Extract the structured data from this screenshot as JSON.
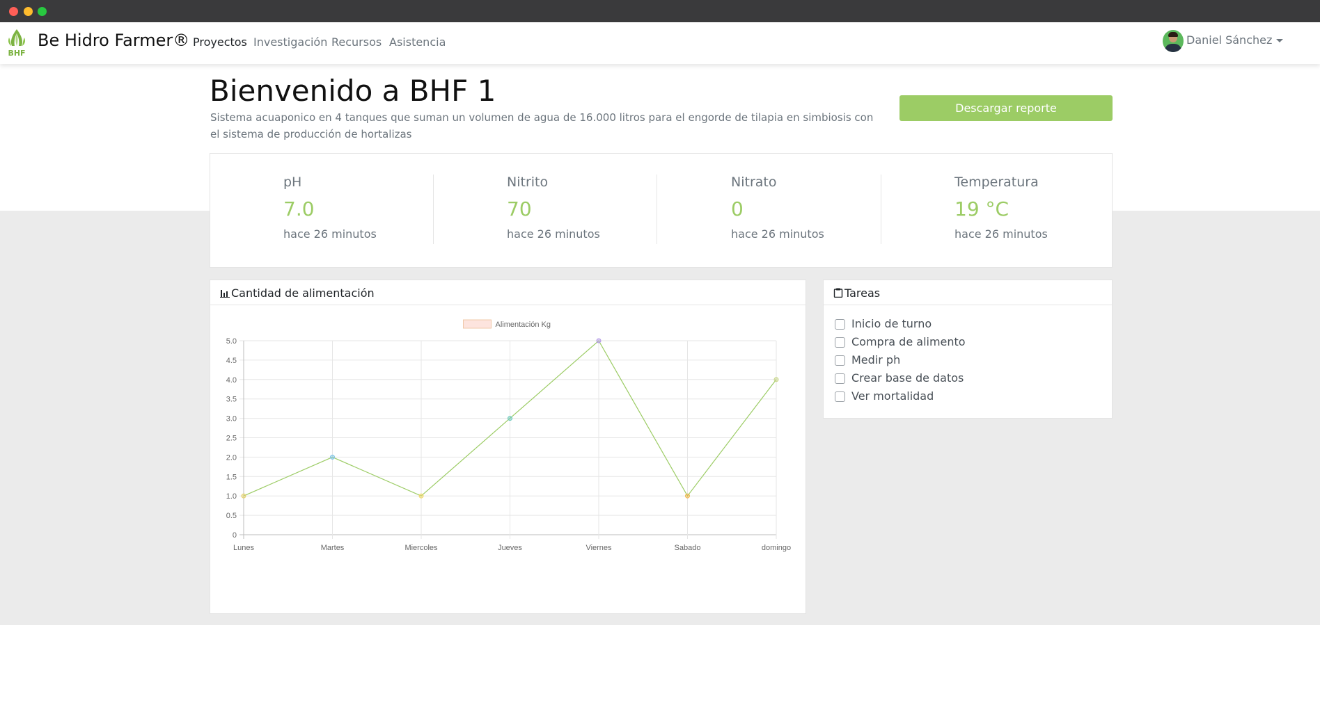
{
  "brand": {
    "logo_text": "BHF",
    "name": "Be Hidro Farmer®",
    "accent": "#9ccc65"
  },
  "nav": {
    "items": [
      {
        "label": "Proyectos",
        "active": true
      },
      {
        "label": "Investigación",
        "active": false
      },
      {
        "label": "Recursos",
        "active": false
      },
      {
        "label": "Asistencia",
        "active": false
      }
    ]
  },
  "user": {
    "name": "Daniel Sánchez"
  },
  "header": {
    "title": "Bienvenido a BHF 1",
    "description": "Sistema acuaponico en 4 tanques que suman un volumen de agua de 16.000 litros para el engorde de tilapia en simbiosis con el sistema de producción de hortalizas",
    "download_label": "Descargar reporte"
  },
  "stats": [
    {
      "label": "pH",
      "value": "7.0",
      "time": "hace 26 minutos"
    },
    {
      "label": "Nitrito",
      "value": "70",
      "time": "hace 26 minutos"
    },
    {
      "label": "Nitrato",
      "value": "0",
      "time": "hace 26 minutos"
    },
    {
      "label": "Temperatura",
      "value": "19 °C",
      "time": "hace 26 minutos"
    }
  ],
  "chart_card": {
    "title": "Cantidad de alimentación",
    "icon": "bar-chart-icon"
  },
  "chart_data": {
    "type": "line",
    "categories": [
      "Lunes",
      "Martes",
      "Miercoles",
      "Jueves",
      "Viernes",
      "Sabado",
      "domingo"
    ],
    "series": [
      {
        "name": "Alimentación Kg",
        "values": [
          1,
          2,
          1,
          3,
          5,
          1,
          4
        ],
        "line_color": "#9ccc65",
        "legend_fill": "#fde4de",
        "legend_border": "#f0c8a8",
        "point_colors": [
          "#e5d16a",
          "#7ec3e6",
          "#f0d86a",
          "#6fcabe",
          "#b39ae6",
          "#f2b54a",
          "#c8d68a"
        ]
      }
    ],
    "ylim": [
      0,
      5
    ],
    "yticks": [
      "0",
      "0.5",
      "1.0",
      "1.5",
      "2.0",
      "2.5",
      "3.0",
      "3.5",
      "4.0",
      "4.5",
      "5.0"
    ],
    "grid": true,
    "legend": "top"
  },
  "tasks_card": {
    "title": "Tareas",
    "icon": "clipboard-icon",
    "items": [
      {
        "label": "Inicio de turno",
        "checked": false
      },
      {
        "label": "Compra de alimento",
        "checked": false
      },
      {
        "label": "Medir ph",
        "checked": false
      },
      {
        "label": "Crear base de datos",
        "checked": false
      },
      {
        "label": "Ver mortalidad",
        "checked": false
      }
    ]
  }
}
